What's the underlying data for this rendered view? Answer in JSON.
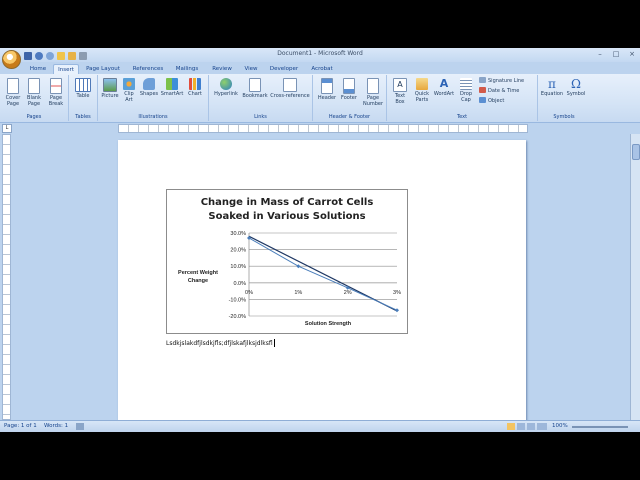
{
  "window": {
    "title": "Document1 - Microsoft Word"
  },
  "tabs": [
    "Home",
    "Insert",
    "Page Layout",
    "References",
    "Mailings",
    "Review",
    "View",
    "Developer",
    "Acrobat"
  ],
  "active_tab": "Insert",
  "ribbon": {
    "groups": {
      "pages": "Pages",
      "tables": "Tables",
      "illustrations": "Illustrations",
      "links": "Links",
      "header_footer": "Header & Footer",
      "text": "Text",
      "symbols": "Symbols"
    },
    "buttons": {
      "cover_page": "Cover Page",
      "blank_page": "Blank Page",
      "page_break": "Page Break",
      "table": "Table",
      "picture": "Picture",
      "clip_art": "Clip Art",
      "shapes": "Shapes",
      "smartart": "SmartArt",
      "chart": "Chart",
      "hyperlink": "Hyperlink",
      "bookmark": "Bookmark",
      "cross_reference": "Cross-reference",
      "header": "Header",
      "footer": "Footer",
      "page_number": "Page Number",
      "text_box": "Text Box",
      "quick_parts": "Quick Parts",
      "wordart": "WordArt",
      "drop_cap": "Drop Cap",
      "signature_line": "Signature Line",
      "date_time": "Date & Time",
      "object": "Object",
      "equation": "Equation",
      "symbol": "Symbol"
    }
  },
  "document": {
    "text": "Lsdkjslakdfjlsdkjfls;dfjlskafjlksjdlksfl"
  },
  "status": {
    "page": "Page: 1 of 1",
    "words": "Words: 1",
    "zoom": "100%"
  },
  "chart_data": {
    "type": "line",
    "title_line1": "Change in Mass of Carrot Cells",
    "title_line2": "Soaked in Various Solutions",
    "xlabel": "Solution Strength",
    "ylabel_line1": "Percent Weight",
    "ylabel_line2": "Change",
    "categories": [
      "0%",
      "1%",
      "2%",
      "3%"
    ],
    "series": [
      {
        "values": [
          0.27,
          0.1,
          -0.03,
          -0.165
        ]
      }
    ],
    "trendline": {
      "from": 0.28,
      "to": -0.17
    },
    "ylim": [
      -0.2,
      0.3
    ],
    "yticks": [
      "30.0%",
      "20.0%",
      "10.0%",
      "0.0%",
      "-10.0%",
      "-20.0%"
    ],
    "grid": true,
    "colors": {
      "series": "#4a7ebb",
      "trendline": "#1f3864"
    }
  }
}
